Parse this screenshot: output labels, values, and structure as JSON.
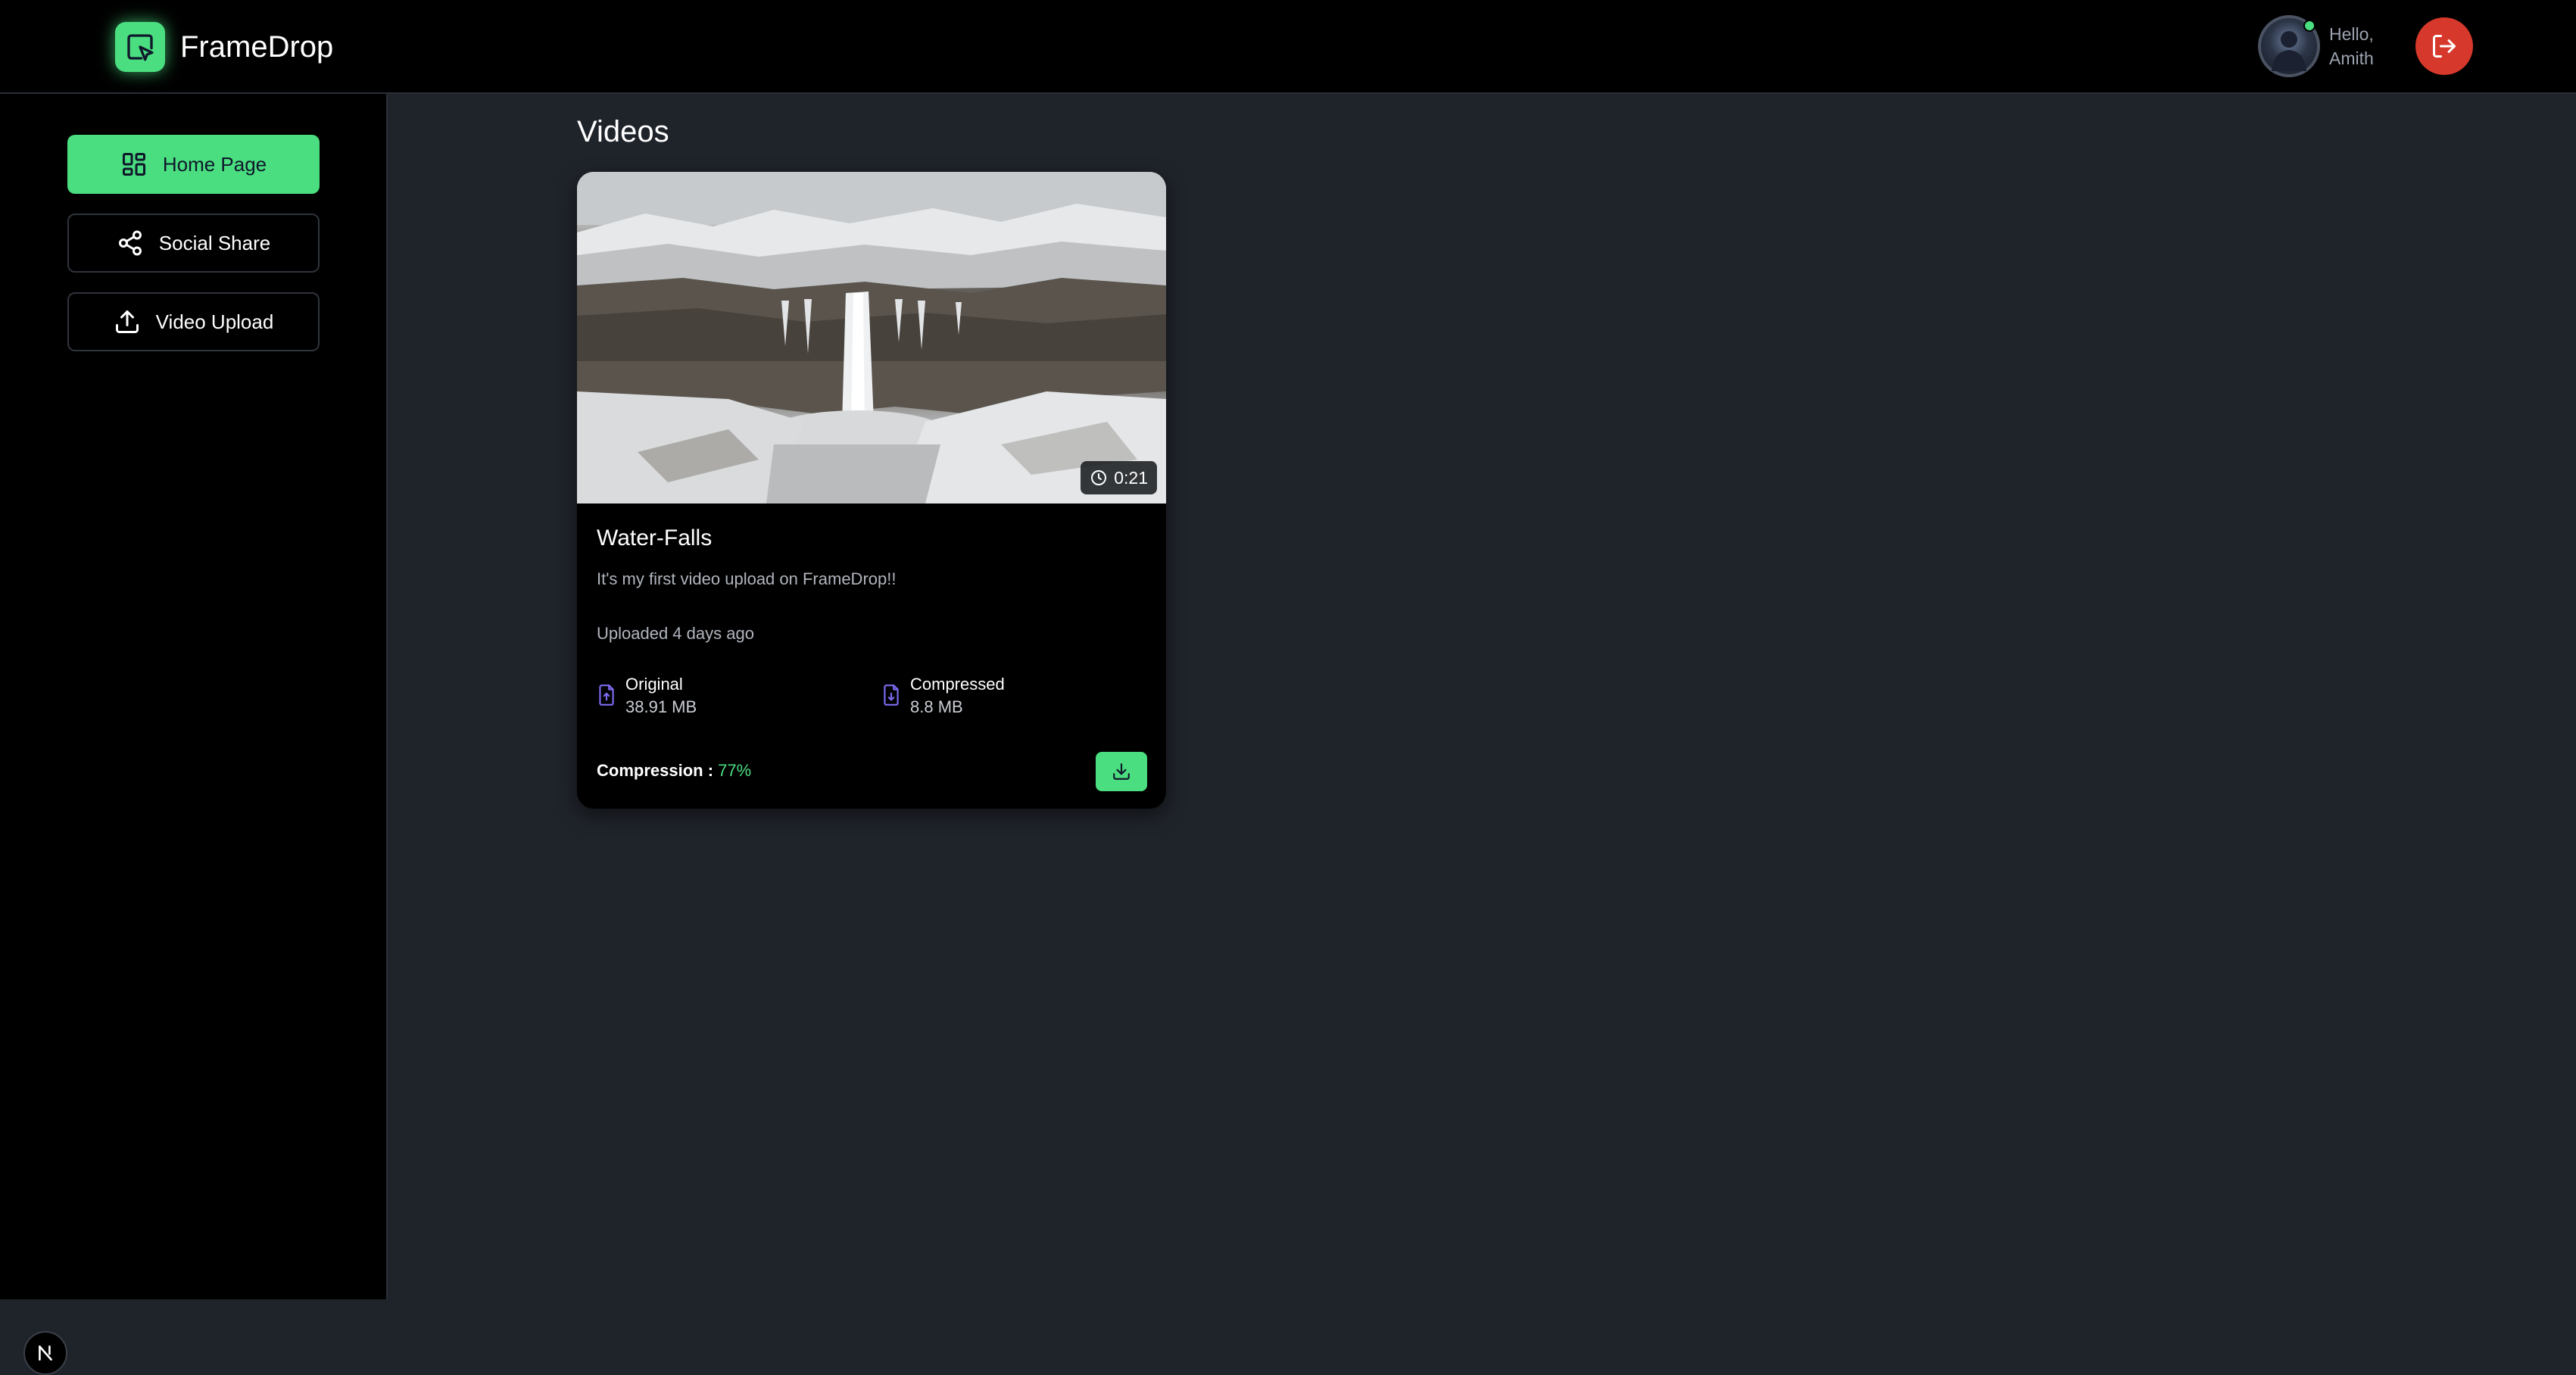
{
  "app": {
    "name": "FrameDrop"
  },
  "header": {
    "greeting_line1": "Hello,",
    "greeting_line2": "Amith",
    "avatar_icon": "user-avatar",
    "logout_icon": "logout-icon"
  },
  "sidebar": {
    "items": [
      {
        "label": "Home Page",
        "icon": "dashboard-icon",
        "active": true
      },
      {
        "label": "Social Share",
        "icon": "share-icon",
        "active": false
      },
      {
        "label": "Video Upload",
        "icon": "upload-icon",
        "active": false
      }
    ],
    "badge": "N"
  },
  "main": {
    "title": "Videos",
    "videos": [
      {
        "title": "Water-Falls",
        "description": "It's my first video upload on FrameDrop!!",
        "duration": "0:21",
        "uploaded": "Uploaded 4 days ago",
        "original_label": "Original",
        "original_size": "38.91 MB",
        "compressed_label": "Compressed",
        "compressed_size": "8.8 MB",
        "compression_label": "Compression :",
        "compression_value": "77%"
      }
    ]
  },
  "colors": {
    "accent": "#4ade80",
    "logout": "#d6392b",
    "background": "#1f232a",
    "sidebar": "#000000",
    "file_icon": "#7c6cf2"
  }
}
